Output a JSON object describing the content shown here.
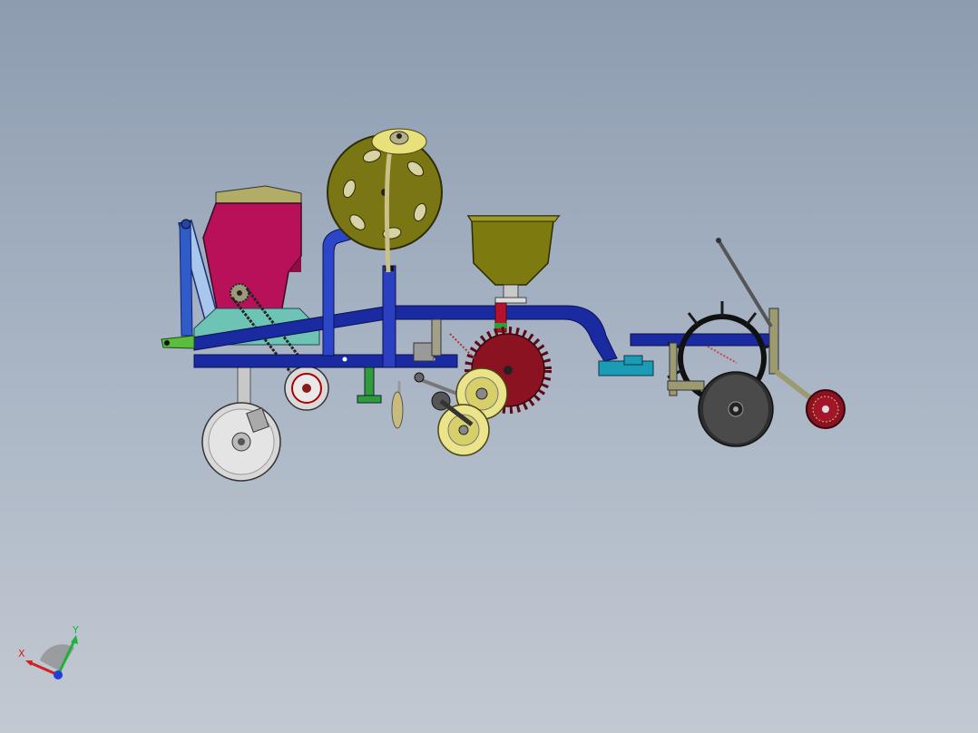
{
  "viewport": {
    "background_top": "#8d9cb0",
    "background_bottom": "#c3c9d1"
  },
  "triad": {
    "x_label": "X",
    "y_label": "Y",
    "x_color": "#d32020",
    "y_color": "#1fb23a",
    "z_color": "#1f3fd8"
  },
  "model": {
    "frame_color": "#13239a",
    "hopper_color": "#b5135a",
    "fertilizer_bin_color": "#6b6a0a",
    "seed_wheel_color": "#8b1221",
    "disc_color": "#d9d9d9",
    "icon": "seeder-assembly-model"
  }
}
